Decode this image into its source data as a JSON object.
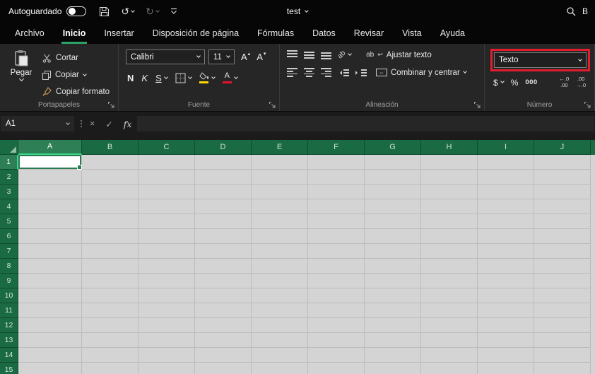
{
  "titlebar": {
    "autosave_label": "Autoguardado",
    "doc_title": "test",
    "search_text": "B"
  },
  "tabs": [
    {
      "label": "Archivo"
    },
    {
      "label": "Inicio"
    },
    {
      "label": "Insertar"
    },
    {
      "label": "Disposición de página"
    },
    {
      "label": "Fórmulas"
    },
    {
      "label": "Datos"
    },
    {
      "label": "Revisar"
    },
    {
      "label": "Vista"
    },
    {
      "label": "Ayuda"
    }
  ],
  "ribbon": {
    "clipboard": {
      "paste": "Pegar",
      "cut": "Cortar",
      "copy": "Copiar",
      "format_painter": "Copiar formato",
      "group_label": "Portapapeles"
    },
    "font": {
      "family": "Calibri",
      "size": "11",
      "bold": "N",
      "italic": "K",
      "underline": "S",
      "fill_color": "#ffd800",
      "font_color": "#e8112d",
      "group_label": "Fuente"
    },
    "alignment": {
      "wrap_text": "Ajustar texto",
      "merge_center": "Combinar y centrar",
      "group_label": "Alineación"
    },
    "number": {
      "format": "Texto",
      "currency": "$",
      "percent": "%",
      "thousands": "000",
      "highlight_color": "#e11d2e",
      "group_label": "Número"
    }
  },
  "formula_bar": {
    "name_box": "A1",
    "cancel": "×",
    "enter": "✓",
    "fx": "fx"
  },
  "icons": {
    "undo": "↺",
    "redo": "↻",
    "grow_font": "A",
    "shrink_font": "A",
    "tri_up": "▴",
    "tri_down": "▾",
    "font_color_letter": "A",
    "orientation_ab": "ab",
    "wrap_ab": "ab",
    "wrap_return": "↩",
    "merge_glyph": "⇔",
    "inc_dec_l1": "←.0",
    "inc_dec_l2": ".00",
    "dec_dec_l1": ".00",
    "dec_dec_l2": "→.0"
  },
  "grid": {
    "columns": [
      "A",
      "B",
      "C",
      "D",
      "E",
      "F",
      "G",
      "H",
      "I",
      "J"
    ],
    "rows": [
      "1",
      "2",
      "3",
      "4",
      "5",
      "6",
      "7",
      "8",
      "9",
      "10",
      "11",
      "12",
      "13",
      "14",
      "15"
    ],
    "selected_cell": "A1"
  }
}
